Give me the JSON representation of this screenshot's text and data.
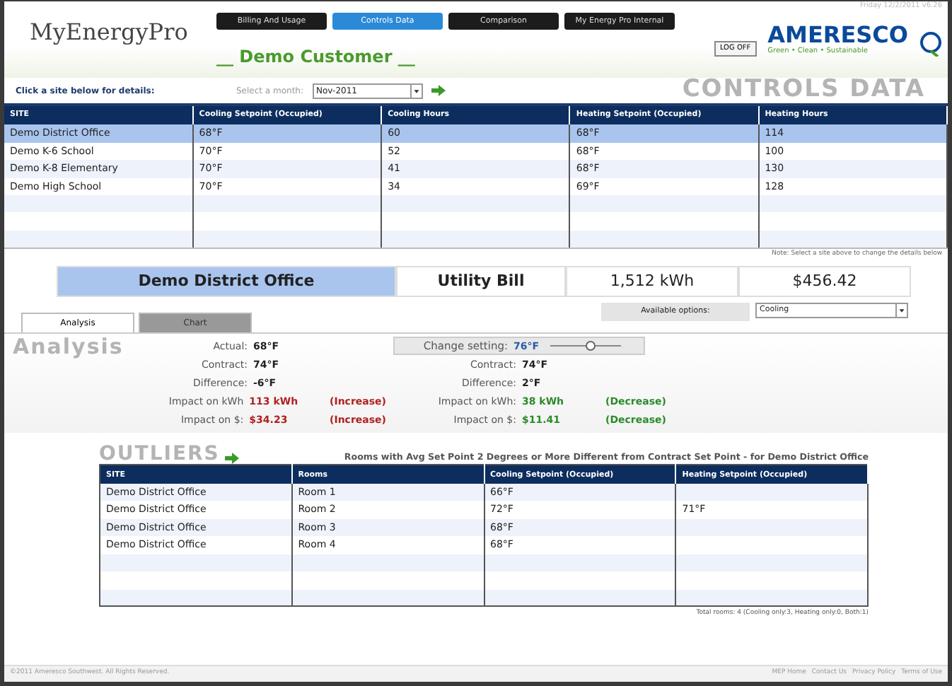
{
  "header": {
    "logo": "MyEnergyPro",
    "nav": [
      {
        "label": "Billing And Usage",
        "selected": false
      },
      {
        "label": "Controls Data",
        "selected": true
      },
      {
        "label": "Comparison",
        "selected": false
      },
      {
        "label": "My Energy Pro Internal",
        "selected": false
      }
    ],
    "customer": "__ Demo Customer __",
    "date": "Friday 12/2/2011 v6.26",
    "logoff": "LOG OFF",
    "brand": "AMERESCO",
    "tagline": "Green • Clean • Sustainable"
  },
  "toolbar": {
    "hint": "Click a site below for details:",
    "month_label": "Select a month:",
    "month": "Nov-2011",
    "section_title": "CONTROLS DATA"
  },
  "sites_table": {
    "columns": [
      "SITE",
      "Cooling Setpoint (Occupied)",
      "Cooling Hours",
      "Heating Setpoint (Occupied)",
      "Heating Hours"
    ],
    "rows": [
      {
        "cells": [
          "Demo District Office",
          "68°F",
          "60",
          "68°F",
          "114"
        ],
        "selected": true
      },
      {
        "cells": [
          "Demo K-6 School",
          "70°F",
          "52",
          "68°F",
          "100"
        ],
        "selected": false
      },
      {
        "cells": [
          "Demo K-8 Elementary",
          "70°F",
          "41",
          "68°F",
          "130"
        ],
        "selected": false
      },
      {
        "cells": [
          "Demo High School",
          "70°F",
          "34",
          "69°F",
          "128"
        ],
        "selected": false
      }
    ],
    "note": "Note: Select a site above to change the details below"
  },
  "summary": {
    "site": "Demo District Office",
    "label": "Utility Bill",
    "energy": "1,512 kWh",
    "cost": "$456.42"
  },
  "tabs": [
    {
      "label": "Analysis",
      "selected": true
    },
    {
      "label": "Chart",
      "selected": false
    }
  ],
  "options": {
    "label": "Available options:",
    "value": "Cooling"
  },
  "analysis": {
    "title": "Analysis",
    "left": [
      {
        "label": "Actual:",
        "value": "68°F",
        "kind": "plain"
      },
      {
        "label": "Contract:",
        "value": "74°F",
        "kind": "plain"
      },
      {
        "label": "Difference:",
        "value": "-6°F",
        "kind": "plain"
      },
      {
        "label": "Impact on kWh",
        "value": "113 kWh",
        "kind": "increase",
        "note": "(Increase)"
      },
      {
        "label": "Impact on $:",
        "value": "$34.23",
        "kind": "increase",
        "note": "(Increase)"
      }
    ],
    "change": {
      "label": "Change setting:",
      "value": "76°F",
      "level": 0.55
    },
    "right": [
      {
        "label": "Contract:",
        "value": "74°F",
        "kind": "plain"
      },
      {
        "label": "Difference:",
        "value": "2°F",
        "kind": "plain"
      },
      {
        "label": "Impact on kWh:",
        "value": "38 kWh",
        "kind": "decrease",
        "note": "(Decrease)"
      },
      {
        "label": "Impact on $:",
        "value": "$11.41",
        "kind": "decrease",
        "note": "(Decrease)"
      }
    ]
  },
  "outliers": {
    "title": "OUTLIERS",
    "caption": "Rooms with Avg Set Point 2 Degrees or More Different from Contract Set Point - for Demo District Office",
    "columns": [
      "SITE",
      "Rooms",
      "Cooling Setpoint (Occupied)",
      "Heating Setpoint (Occupied)"
    ],
    "rows": [
      [
        "Demo District Office",
        "Room 1",
        "66°F",
        ""
      ],
      [
        "Demo District Office",
        "Room 2",
        "72°F",
        "71°F"
      ],
      [
        "Demo District Office",
        "Room 3",
        "68°F",
        ""
      ],
      [
        "Demo District Office",
        "Room 4",
        "68°F",
        ""
      ]
    ],
    "total": "Total rooms: 4  (Cooling only:3, Heating only:0, Both:1)"
  },
  "footer": {
    "copyright": "©2011 Ameresco Southwest. All Rights Reserved.",
    "links": [
      "MEP Home",
      "Contact Us",
      "Privacy Policy",
      "Terms of Use"
    ]
  }
}
